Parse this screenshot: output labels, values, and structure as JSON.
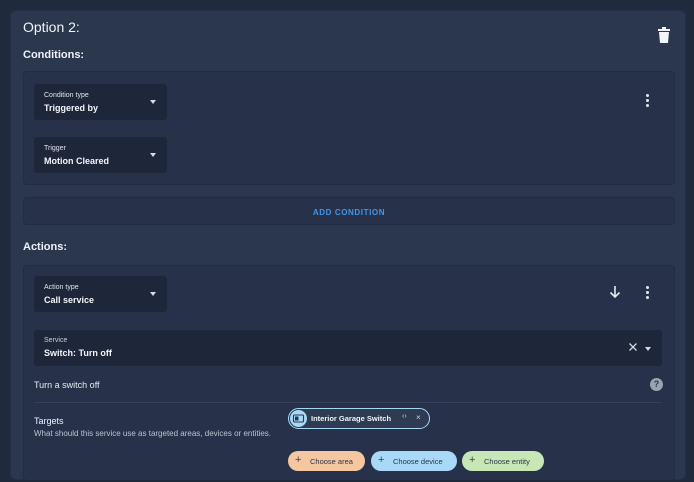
{
  "option": {
    "title": "Option 2:"
  },
  "conditions": {
    "heading": "Conditions:",
    "condition_type": {
      "label": "Condition type",
      "value": "Triggered by"
    },
    "trigger": {
      "label": "Trigger",
      "value": "Motion Cleared"
    },
    "add_label": "ADD CONDITION"
  },
  "actions": {
    "heading": "Actions:",
    "action_type": {
      "label": "Action type",
      "value": "Call service"
    },
    "service": {
      "label": "Service",
      "value": "Switch: Turn off"
    },
    "description": "Turn a switch off",
    "help_glyph": "?",
    "targets": {
      "title": "Targets",
      "description": "What should this service use as targeted areas, devices or entities.",
      "entity_chip": {
        "label": "Interior Garage Switch",
        "code_glyph": "‹›",
        "remove_glyph": "×"
      },
      "choose_area": "Choose area",
      "choose_device": "Choose device",
      "choose_entity": "Choose entity"
    }
  },
  "colors": {
    "accent": "#3f97e8",
    "area_chip": "#f5c7a1",
    "device_chip": "#a8d9f7",
    "entity_chip": "#c9e6b6"
  },
  "icons": [
    "trash-icon",
    "overflow-menu-icon",
    "arrow-down-icon",
    "clear-icon",
    "dropdown-arrow-icon",
    "help-icon",
    "switch-icon",
    "plus-icon"
  ]
}
